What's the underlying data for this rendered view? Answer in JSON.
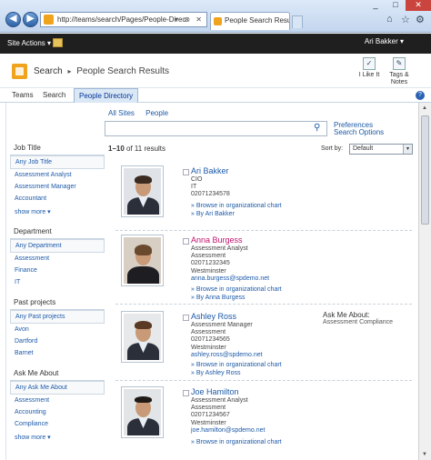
{
  "browser": {
    "address": "http://teams/search/Pages/People-Direc",
    "tab_title": "People Search Results :",
    "back": "◀",
    "forward": "▶",
    "addr_controls": "▾ ⊗ ✕",
    "win_min": "_",
    "win_max": "□",
    "win_close": "✕"
  },
  "ribbon": {
    "site_actions": "Site Actions ▾",
    "user": "Ari Bakker ▾"
  },
  "header": {
    "crumb_root": "Search",
    "crumb_sep": "▸",
    "crumb_current": "People Search Results",
    "like_label": "I Like It",
    "tags_label": "Tags &",
    "tags_label2": "Notes"
  },
  "topnav": {
    "items": [
      "Teams",
      "Search",
      "People Directory"
    ],
    "help": "?"
  },
  "search": {
    "scope_all": "All Sites",
    "scope_people": "People",
    "prefs": "Preferences",
    "options": "Search Options",
    "search_glyph": "⚲"
  },
  "refiners": {
    "job_title": {
      "heading": "Job Title",
      "any": "Any Job Title",
      "items": [
        "Assessment Analyst",
        "Assessment Manager",
        "Accountant"
      ],
      "more": "show more ▾"
    },
    "department": {
      "heading": "Department",
      "any": "Any Department",
      "items": [
        "Assessment",
        "Finance",
        "IT"
      ]
    },
    "past_projects": {
      "heading": "Past projects",
      "any": "Any Past projects",
      "items": [
        "Avon",
        "Dartford",
        "Barnet"
      ]
    },
    "ask_me_about": {
      "heading": "Ask Me About",
      "any": "Any Ask Me About",
      "items": [
        "Assessment",
        "Accounting",
        "Compliance"
      ],
      "more": "show more ▾"
    }
  },
  "results_header": {
    "range": "1–10",
    "of_text": "of 11 results",
    "sort_label": "Sort by:",
    "sort_value": "Default",
    "sort_dd": "▾"
  },
  "results": [
    {
      "name": "Ari Bakker",
      "lines": [
        "CIO",
        "IT",
        "02071234578"
      ],
      "email": "",
      "browse": "» Browse in organizational chart",
      "by": "» By Ari Bakker",
      "ask_label": "",
      "ask_value": ""
    },
    {
      "name": "Anna Burgess",
      "lines": [
        "Assessment Analyst",
        "Assessment",
        "02071232345",
        "Westminster"
      ],
      "email": "anna.burgess@spdemo.net",
      "browse": "» Browse in organizational chart",
      "by": "» By Anna Burgess",
      "ask_label": "",
      "ask_value": ""
    },
    {
      "name": "Ashley Ross",
      "lines": [
        "Assessment Manager",
        "Assessment",
        "02071234565",
        "Westminster"
      ],
      "email": "ashley.ross@spdemo.net",
      "browse": "» Browse in organizational chart",
      "by": "» By Ashley Ross",
      "ask_label": "Ask Me About:",
      "ask_value": "Assessment   Compliance"
    },
    {
      "name": "Joe Hamilton",
      "lines": [
        "Assessment Analyst",
        "Assessment",
        "02071234567",
        "Westminster"
      ],
      "email": "joe.hamilton@spdemo.net",
      "browse": "» Browse in organizational chart",
      "by": "",
      "ask_label": "",
      "ask_value": ""
    }
  ],
  "colors": {
    "link": "#1d5aa8",
    "highlight_name": "#c0146d",
    "ribbon": "#1f1f1f",
    "brand": "#f0a31d"
  }
}
